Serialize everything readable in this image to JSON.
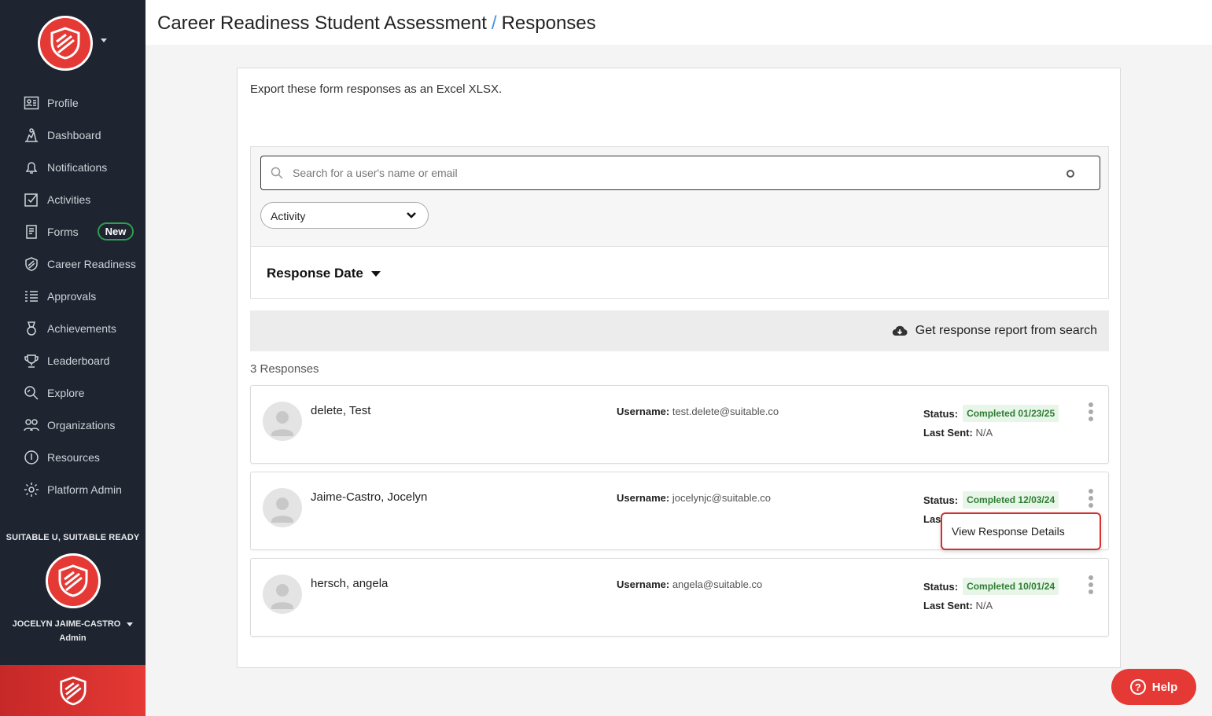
{
  "sidebar": {
    "items": [
      {
        "label": "Profile"
      },
      {
        "label": "Dashboard"
      },
      {
        "label": "Notifications"
      },
      {
        "label": "Activities"
      },
      {
        "label": "Forms",
        "badge": "New"
      },
      {
        "label": "Career Readiness"
      },
      {
        "label": "Approvals"
      },
      {
        "label": "Achievements"
      },
      {
        "label": "Leaderboard"
      },
      {
        "label": "Explore"
      },
      {
        "label": "Organizations"
      },
      {
        "label": "Resources"
      },
      {
        "label": "Platform Admin"
      }
    ],
    "org_label": "SUITABLE U, SUITABLE READY",
    "user_name": "JOCELYN JAIME-CASTRO",
    "user_role": "Admin"
  },
  "header": {
    "title": "Career Readiness Student Assessment",
    "separator": "/",
    "subtitle": "Responses"
  },
  "main": {
    "export_text": "Export these form responses as an Excel XLSX.",
    "search_placeholder": "Search for a user's name or email",
    "activity_select": "Activity",
    "sort_label": "Response Date",
    "report_button": "Get response report from search",
    "count_text": "3 Responses",
    "responses": [
      {
        "name": "delete, Test",
        "username_label": "Username:",
        "username": "test.delete@suitable.co",
        "status_label": "Status:",
        "status": "Completed 01/23/25",
        "last_sent_label": "Last Sent:",
        "last_sent": "N/A"
      },
      {
        "name": "Jaime-Castro, Jocelyn",
        "username_label": "Username:",
        "username": "jocelynjc@suitable.co",
        "status_label": "Status:",
        "status": "Completed 12/03/24",
        "last_sent_label": "Las",
        "last_sent": ""
      },
      {
        "name": "hersch, angela",
        "username_label": "Username:",
        "username": "angela@suitable.co",
        "status_label": "Status:",
        "status": "Completed 10/01/24",
        "last_sent_label": "Last Sent:",
        "last_sent": "N/A"
      }
    ],
    "context_menu_item": "View Response Details"
  },
  "help_button": "Help",
  "colors": {
    "sidebar_bg": "#1e2430",
    "brand_red": "#e53935",
    "status_green": "#2e7d32",
    "accent_blue": "#4a90d9"
  }
}
